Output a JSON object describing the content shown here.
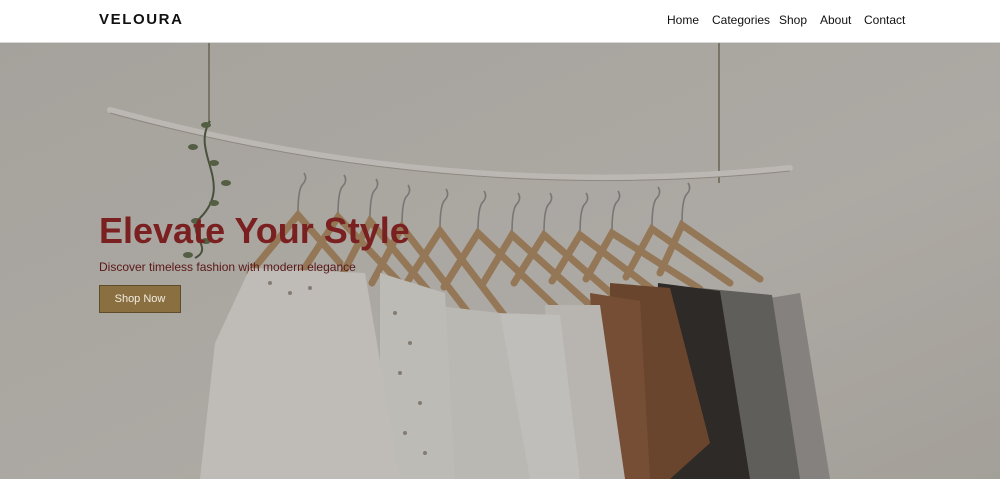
{
  "brand": {
    "name": "VELOURA"
  },
  "nav": {
    "items": [
      {
        "label": "Home"
      },
      {
        "label": "Categories"
      },
      {
        "label": "Shop"
      },
      {
        "label": "About"
      },
      {
        "label": "Contact"
      }
    ]
  },
  "hero": {
    "title": "Elevate Your Style",
    "subtitle": "Discover timeless fashion with modern elegance",
    "cta_label": "Shop Now",
    "image": "clothing-rack-photo"
  },
  "colors": {
    "title": "#7a2020",
    "cta_background": "#8a7040",
    "navbar_background": "#ffffff"
  }
}
